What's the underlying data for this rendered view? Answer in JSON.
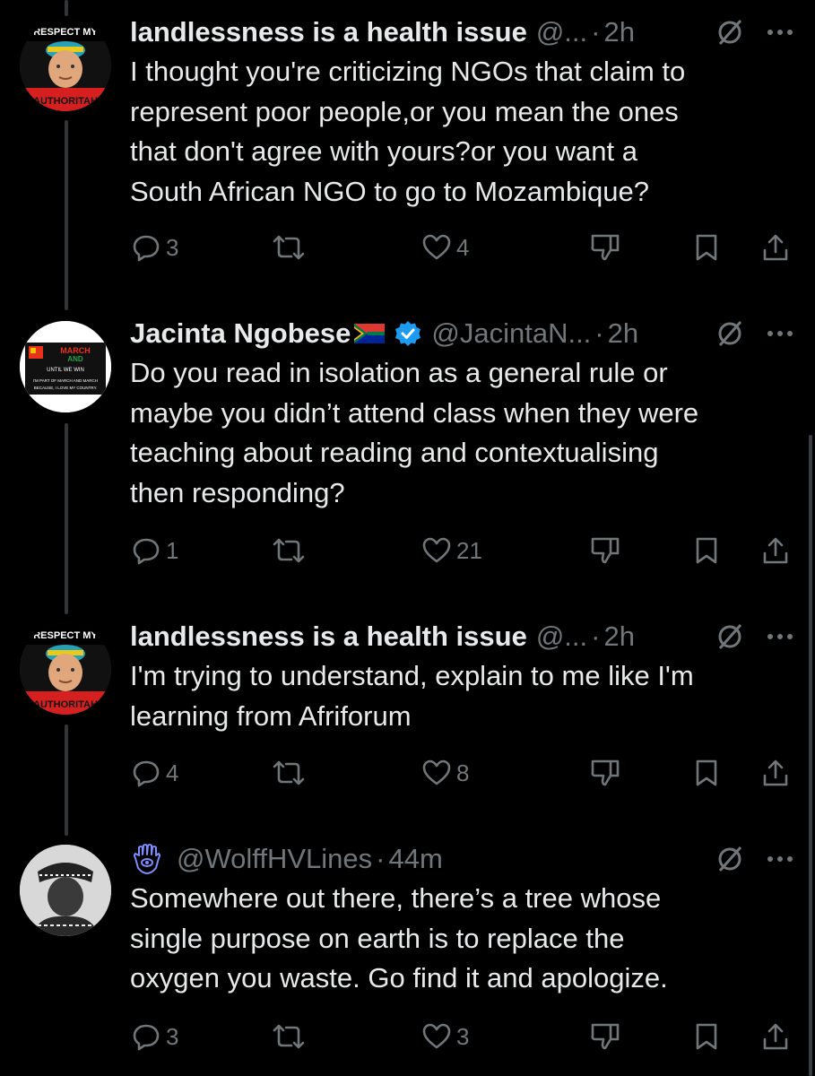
{
  "tweets": [
    {
      "name": "landlessness is a health issue",
      "handle": "@...",
      "dot": "·",
      "time": "2h",
      "text": "I thought you're criticizing NGOs that claim to represent poor people,or you mean the ones that don't agree with yours?or you want a South African NGO to go to Mozambique?",
      "lines": [
        "I thought you're criticizing NGOs that claim to",
        "represent poor people,or you mean the ones",
        "that don't agree with yours?or you want a",
        "South African NGO to go to Mozambique?"
      ],
      "avatar_text_top": "RESPECT MY",
      "avatar_text_bottom": "AUTHORITAH",
      "replies": "3",
      "reposts": "",
      "likes": "4"
    },
    {
      "name": "Jacinta Ngobese",
      "verified": true,
      "handle": "@JacintaN...",
      "dot": "·",
      "time": "2h",
      "lines": [
        "Do you read in isolation as a general rule or",
        "maybe you didn’t attend class when they were",
        "teaching about reading and contextualising",
        "then responding?"
      ],
      "avatar_text_top": "MARCH AND APPLY",
      "avatar_text_mid": "UNTIL WE WIN",
      "avatar_text_bottom": "I'M PART OF MARCH AND MARCH BECAUSE, I LOVE MY COUNTRY.",
      "replies": "1",
      "reposts": "",
      "likes": "21"
    },
    {
      "name": "landlessness is a health issue",
      "handle": "@...",
      "dot": "·",
      "time": "2h",
      "lines": [
        "I'm trying to understand, explain to me like I'm",
        "learning from Afriforum"
      ],
      "avatar_text_top": "RESPECT MY",
      "avatar_text_bottom": "AUTHORITAH",
      "replies": "4",
      "reposts": "",
      "likes": "8"
    },
    {
      "name": "",
      "handle": "@WolffHVLines",
      "dot": "·",
      "time": "44m",
      "lines": [
        "Somewhere out there, there’s a tree whose",
        "single purpose on earth is to replace the",
        "oxygen you waste. Go find it and apologize."
      ],
      "replies": "3",
      "reposts": "",
      "likes": "3"
    }
  ],
  "icons": {
    "reply": "reply-icon",
    "repost": "repost-icon",
    "like": "heart-icon",
    "dislike": "dislike-icon",
    "bookmark": "bookmark-icon",
    "share": "share-icon",
    "grok": "grok-icon",
    "more": "more-icon",
    "verified": "verified-badge-icon",
    "hamsa": "hamsa-icon",
    "flag": "south-africa-flag-icon"
  },
  "colors": {
    "background": "#000000",
    "text": "#e7e9ea",
    "muted": "#71767b",
    "verified": "#1d9bf0"
  }
}
